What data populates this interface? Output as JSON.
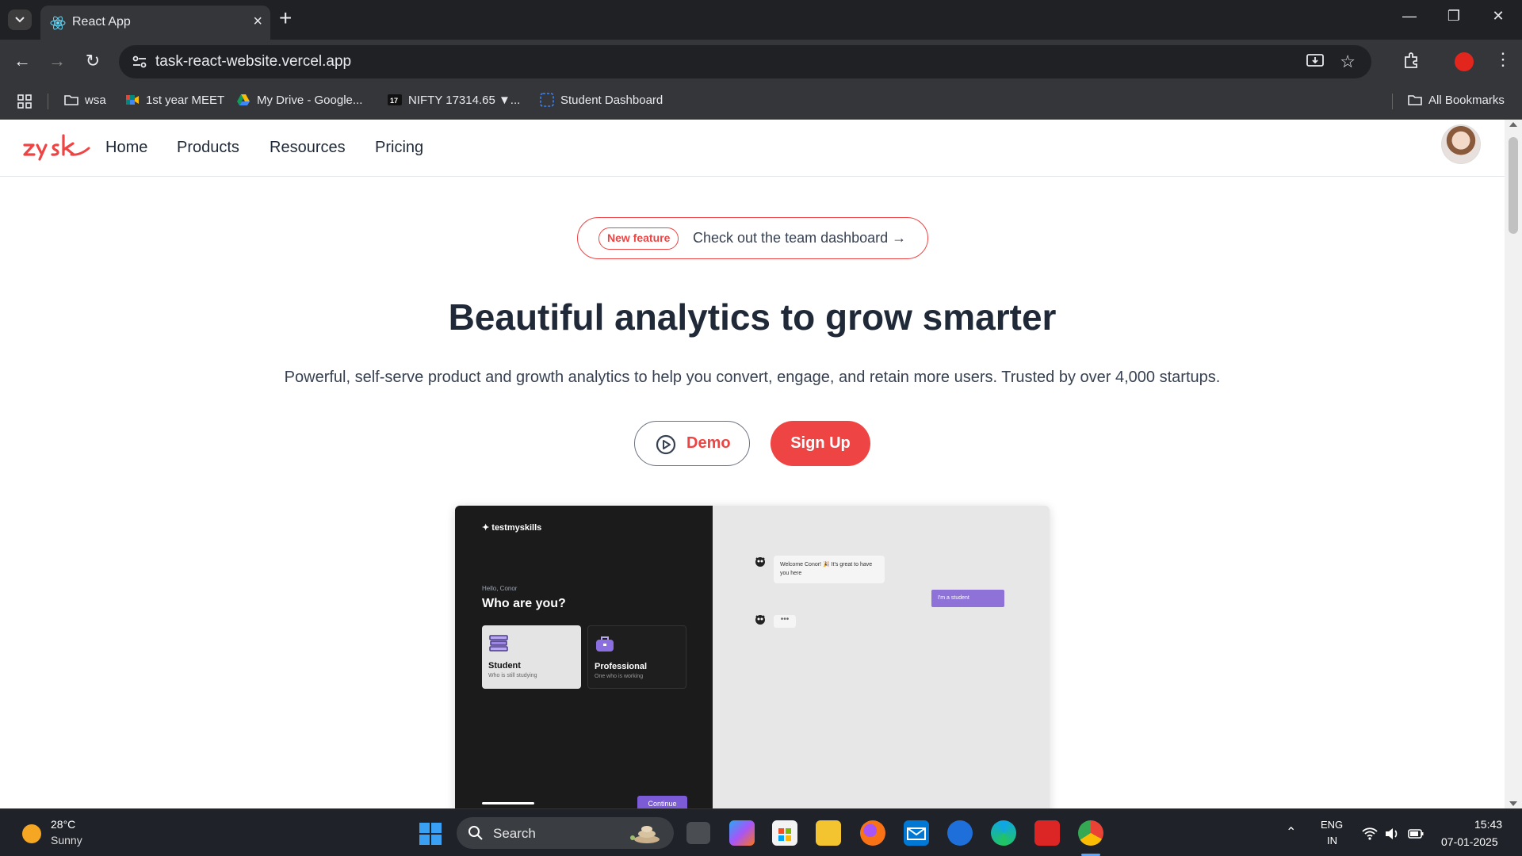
{
  "browser": {
    "tab_title": "React App",
    "url": "task-react-website.vercel.app",
    "bookmarks": [
      {
        "label": "wsa",
        "icon": "folder-icon"
      },
      {
        "label": "1st year MEET",
        "icon": "meet-icon"
      },
      {
        "label": "My Drive - Google...",
        "icon": "drive-icon"
      },
      {
        "label": "NIFTY 17314.65 ▼...",
        "icon": "tradingview-icon"
      },
      {
        "label": "Student Dashboard",
        "icon": "dashboard-icon"
      }
    ],
    "all_bookmarks": "All Bookmarks"
  },
  "site": {
    "nav": [
      "Home",
      "Products",
      "Resources",
      "Pricing"
    ],
    "feature_badge": "New feature",
    "feature_text": "Check out the team dashboard →",
    "headline": "Beautiful analytics to grow smarter",
    "subtext": "Powerful, self-serve product and growth analytics to help you convert, engage, and retain more users. Trusted by over 4,000 startups.",
    "demo_label": "Demo",
    "signup_label": "Sign Up",
    "accent": "#ef4444"
  },
  "preview": {
    "brand": "testmyskills",
    "hello": "Hello, Conor",
    "question": "Who are you?",
    "student_title": "Student",
    "student_sub": "Who is still studying",
    "pro_title": "Professional",
    "pro_sub": "One who is working",
    "continue": "Continue",
    "bot_message": "Welcome Conor! 🎉 It's great to have you here",
    "user_message": "I'm a student",
    "typing": "•••"
  },
  "taskbar": {
    "temp": "28°C",
    "condition": "Sunny",
    "search": "Search",
    "lang_line1": "ENG",
    "lang_line2": "IN",
    "time": "15:43",
    "date": "07-01-2025"
  }
}
